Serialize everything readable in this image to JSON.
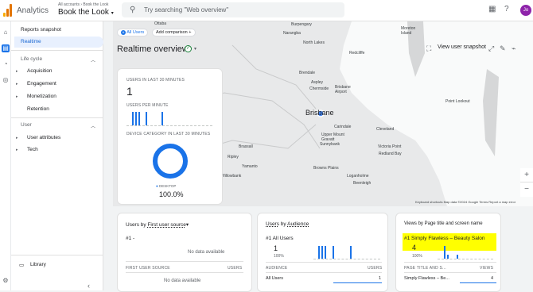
{
  "app": {
    "name": "Analytics",
    "breadcrumb": "All accounts › Book the Look",
    "property": "Book the Look",
    "search_placeholder": "Try searching \"Web overview\"",
    "avatar_initials": "Jo"
  },
  "colors": {
    "accent": "#1a73e8",
    "highlight": "#ffff00",
    "check": "#188038",
    "avatar": "#8e24aa"
  },
  "sidebar": {
    "reports_snapshot": "Reports snapshot",
    "realtime": "Realtime",
    "lifecycle_header": "Life cycle",
    "lifecycle_items": [
      "Acquisition",
      "Engagement",
      "Monetization",
      "Retention"
    ],
    "user_header": "User",
    "user_items": [
      "User attributes",
      "Tech"
    ],
    "library": "Library"
  },
  "toolbar": {
    "all_users": "All Users",
    "add_comparison": "Add comparison",
    "title": "Realtime overview",
    "view_user_snapshot": "View user snapshot"
  },
  "map": {
    "labels": [
      "Ottaba",
      "Burpengary",
      "Narangba",
      "Moreton Island",
      "North Lakes",
      "Redcliffe",
      "Brendale",
      "Aspley",
      "Chermside",
      "Brisbane Airport",
      "Point Lookout",
      "Carindale",
      "Cleveland",
      "Upper Mount Gravatt",
      "Sunnybank",
      "Victoria Point",
      "Redland Bay",
      "Brassall",
      "Ripley",
      "Yamanto",
      "Browns Plains",
      "Loganholme",
      "Beenleigh",
      "Willowbank"
    ],
    "city": "Brisbane",
    "attribution": "Keyboard shortcuts   Map data ©2024 Google   Terms   Report a map error"
  },
  "users_card": {
    "users_label": "USERS IN LAST 30 MINUTES",
    "users_value": "1",
    "per_minute_label": "USERS PER MINUTE",
    "device_label": "DEVICE CATEGORY IN LAST 30 MINUTES",
    "device_legend": "DESKTOP",
    "device_value": "100.0%",
    "per_minute_bars": [
      1,
      1,
      1,
      1,
      1
    ]
  },
  "first_source_card": {
    "title_prefix": "Users by ",
    "title_link": "First user source",
    "rank": "#1",
    "no_data_top": "No data available",
    "col1": "FIRST USER SOURCE",
    "col2": "USERS",
    "no_data_bottom": "No data available"
  },
  "audience_card": {
    "title_prefix": "Users",
    "title_mid": " by ",
    "title_link": "Audience",
    "rank_label": "#1  All Users",
    "value": "1",
    "percent": "100%",
    "col1": "AUDIENCE",
    "col2": "USERS",
    "row_name": "All Users",
    "row_value": "1",
    "bars": [
      1,
      1,
      1,
      1,
      1
    ]
  },
  "views_card": {
    "title": "Views by Page title and screen name",
    "rank_label": "#1  Simply Flawless – Beauty Salon",
    "value": "4",
    "percent": "100%",
    "col1": "PAGE TITLE AND S...",
    "col2": "VIEWS",
    "row_name": "Simply Flawless – Be...",
    "row_value": "4",
    "bars": [
      3,
      1,
      1
    ]
  }
}
